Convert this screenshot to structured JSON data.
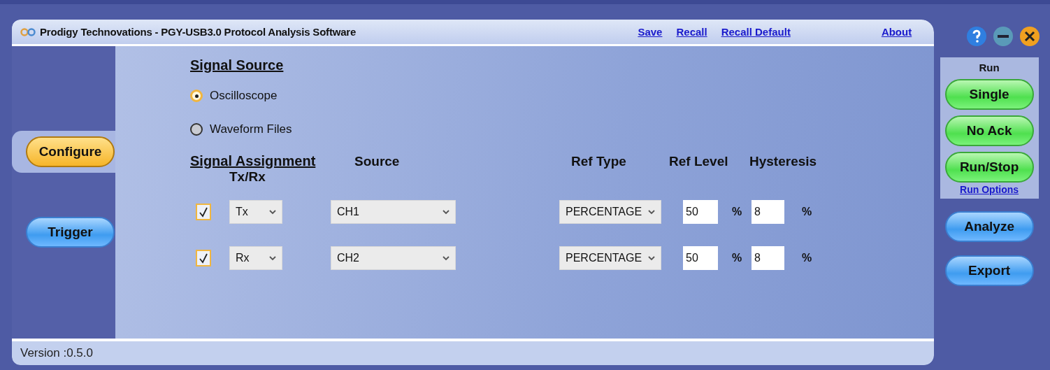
{
  "window": {
    "title": "Prodigy Technovations - PGY-USB3.0 Protocol Analysis Software",
    "links": [
      "Save",
      "Recall",
      "Recall Default"
    ],
    "about_link": "About"
  },
  "nav": [
    {
      "label": "Configure",
      "selected": true
    },
    {
      "label": "Trigger",
      "selected": false
    }
  ],
  "signal_source": {
    "title": "Signal Source",
    "options": [
      {
        "label": "Oscilloscope",
        "selected": true
      },
      {
        "label": "Waveform Files",
        "selected": false
      }
    ]
  },
  "signal_assignment": {
    "title": "Signal Assignment",
    "columns": [
      "Tx/Rx",
      "Source",
      "Ref Type",
      "Ref Level",
      "Hysteresis"
    ],
    "rows": [
      {
        "checked": true,
        "txrx": "Tx",
        "source": "CH1",
        "ref_type": "PERCENTAGE",
        "ref_level": "50",
        "ref_level_unit": "%",
        "hysteresis": "8",
        "hysteresis_unit": "%"
      },
      {
        "checked": true,
        "txrx": "Rx",
        "source": "CH2",
        "ref_type": "PERCENTAGE",
        "ref_level": "50",
        "ref_level_unit": "%",
        "hysteresis": "8",
        "hysteresis_unit": "%"
      }
    ]
  },
  "run_panel": {
    "title": "Run",
    "buttons": [
      "Single",
      "No Ack",
      "Run/Stop"
    ],
    "link": "Run Options"
  },
  "actions": [
    "Analyze",
    "Export"
  ],
  "status_bar": {
    "version": "Version :0.5.0"
  }
}
